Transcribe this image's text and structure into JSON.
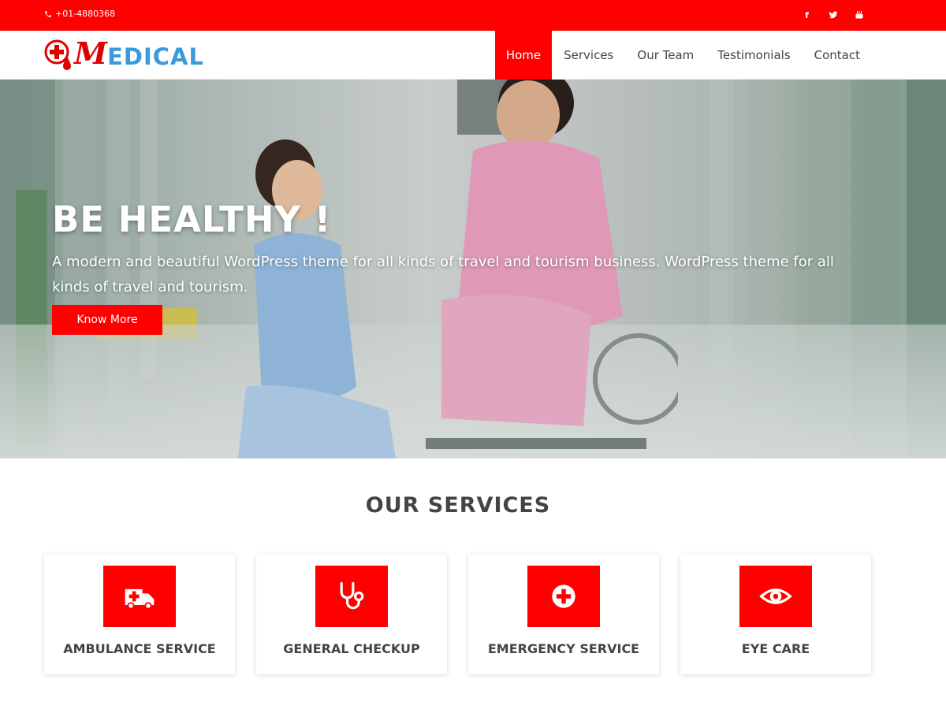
{
  "topbar": {
    "phone": "+01-4880368",
    "social": [
      "facebook-icon",
      "twitter-icon",
      "youtube-icon"
    ]
  },
  "header": {
    "logo_initial": "M",
    "logo_rest": "EDICAL",
    "nav": [
      {
        "label": "Home",
        "active": true
      },
      {
        "label": "Services",
        "active": false
      },
      {
        "label": "Our Team",
        "active": false
      },
      {
        "label": "Testimonials",
        "active": false
      },
      {
        "label": "Contact",
        "active": false
      }
    ]
  },
  "hero": {
    "title": "BE HEALTHY !",
    "subtitle": "A modern and beautiful WordPress theme for all kinds of travel and tourism business. WordPress theme for all kinds of travel and tourism.",
    "button": "Know More"
  },
  "services": {
    "title": "OUR SERVICES",
    "items": [
      {
        "label": "AMBULANCE SERVICE",
        "icon": "ambulance-icon"
      },
      {
        "label": "GENERAL CHECKUP",
        "icon": "stethoscope-icon"
      },
      {
        "label": "EMERGENCY SERVICE",
        "icon": "medical-cross-icon"
      },
      {
        "label": "EYE CARE",
        "icon": "eye-icon"
      }
    ]
  },
  "colors": {
    "accent": "#ff0000",
    "logo_blue": "#3a9bdc",
    "text": "#444444"
  }
}
